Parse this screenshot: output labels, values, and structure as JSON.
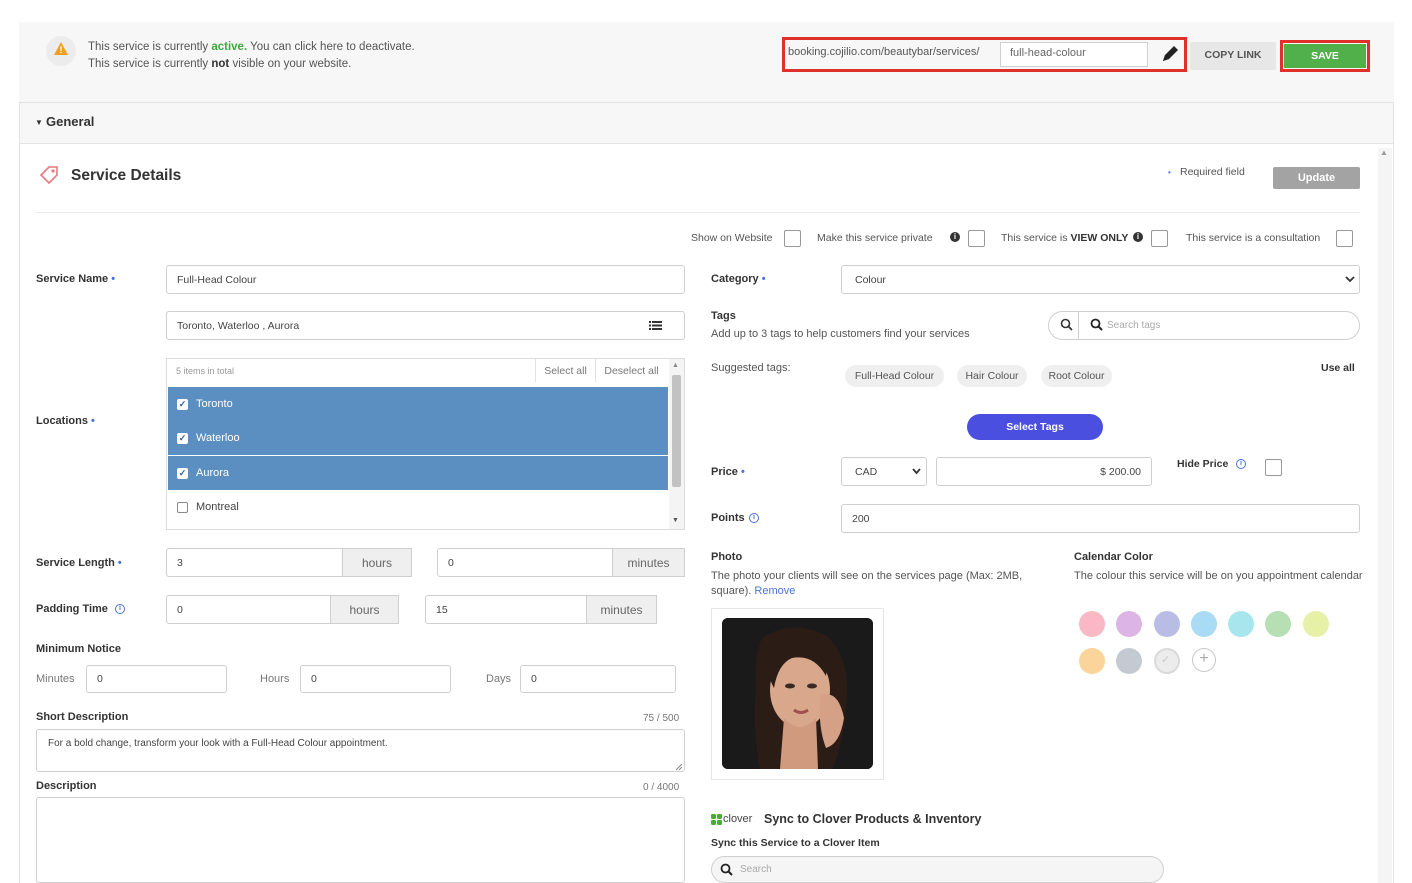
{
  "status": {
    "line1_prefix": "This service is currently",
    "line1_status": "active.",
    "line1_suffix": "You can click here to deactivate.",
    "line2_prefix": "This service is currently",
    "line2_status": "not",
    "line2_suffix": "visible on your website."
  },
  "url": {
    "base": "booking.cojilio.com/beautybar/services/",
    "slug": "full-head-colour"
  },
  "actions": {
    "copy_link": "COPY LINK",
    "save": "SAVE"
  },
  "section": {
    "title": "General"
  },
  "details": {
    "title": "Service Details",
    "required_note": "Required field",
    "update_label": "Update",
    "options": {
      "show_on_website": "Show on Website",
      "make_private": "Make this service private",
      "view_only_prefix": "This service is",
      "view_only_strong": "VIEW ONLY",
      "consultation": "This service is a consultation"
    },
    "required_mark": "•"
  },
  "service_name": {
    "label": "Service Name",
    "value": "Full-Head Colour"
  },
  "locations": {
    "label": "Locations",
    "selected_text": "Toronto, Waterloo , Aurora",
    "count_text": "5 items in total",
    "select_all": "Select all",
    "deselect_all": "Deselect all",
    "items": [
      {
        "name": "Toronto",
        "checked": true
      },
      {
        "name": "Waterloo",
        "checked": true
      },
      {
        "name": "Aurora",
        "checked": true
      },
      {
        "name": "Montreal",
        "checked": false
      }
    ]
  },
  "service_length": {
    "label": "Service Length",
    "hours": "3",
    "hours_unit": "hours",
    "minutes": "0",
    "minutes_unit": "minutes"
  },
  "padding_time": {
    "label": "Padding Time",
    "hours": "0",
    "hours_unit": "hours",
    "minutes": "15",
    "minutes_unit": "minutes"
  },
  "minimum_notice": {
    "label": "Minimum Notice",
    "minutes_label": "Minutes",
    "minutes": "0",
    "hours_label": "Hours",
    "hours": "0",
    "days_label": "Days",
    "days": "0"
  },
  "short_description": {
    "label": "Short Description",
    "counter": "75 / 500",
    "value": "For a bold change, transform your look with a Full-Head Colour appointment."
  },
  "description": {
    "label": "Description",
    "counter": "0 / 4000",
    "value": ""
  },
  "category": {
    "label": "Category",
    "value": "Colour"
  },
  "tags": {
    "label": "Tags",
    "help": "Add up to 3 tags to help customers find your services",
    "search_placeholder": "Search tags",
    "suggested_label": "Suggested tags:",
    "suggested": [
      "Full-Head Colour",
      "Hair Colour",
      "Root Colour"
    ],
    "use_all": "Use all",
    "select_button": "Select Tags"
  },
  "price": {
    "label": "Price",
    "currency": "CAD",
    "value": "$ 200.00",
    "hide_label": "Hide Price"
  },
  "points": {
    "label": "Points",
    "value": "200"
  },
  "photo": {
    "label": "Photo",
    "help": "The photo your clients will see on the services page (Max: 2MB, square).",
    "remove": "Remove"
  },
  "calendar_color": {
    "label": "Calendar Color",
    "help": "The colour this service will be on you appointment calendar",
    "colors": [
      "#f9b8c4",
      "#dcb4e6",
      "#b9bde6",
      "#a9dcf4",
      "#a6e6ec",
      "#b6e0b4",
      "#e6f0a6",
      "#fbd49c",
      "#c4cad2",
      "#ececec"
    ]
  },
  "clover": {
    "logo": "clover",
    "title": "Sync to Clover Products & Inventory",
    "subtitle": "Sync this Service to a Clover Item",
    "search_placeholder": "Search"
  },
  "accent_colors": {
    "active": "#3cab3c",
    "save": "#52b04a",
    "highlight": "#e0302a",
    "selection": "#5c8fc1",
    "primary_pill": "#4b4fe0"
  }
}
